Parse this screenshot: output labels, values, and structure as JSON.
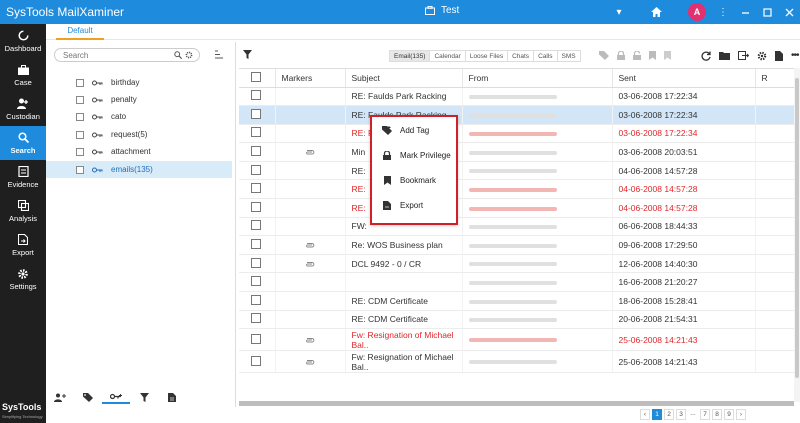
{
  "app": {
    "title": "SysTools MailXaminer",
    "case_name": "Test",
    "avatar_letter": "A"
  },
  "sidebar": {
    "items": [
      {
        "label": "Dashboard",
        "icon": "dashboard-icon"
      },
      {
        "label": "Case",
        "icon": "briefcase-icon"
      },
      {
        "label": "Custodian",
        "icon": "custodian-icon"
      },
      {
        "label": "Search",
        "icon": "search-icon",
        "active": true
      },
      {
        "label": "Evidence",
        "icon": "evidence-icon"
      },
      {
        "label": "Analysis",
        "icon": "analysis-icon"
      },
      {
        "label": "Export",
        "icon": "export-icon"
      },
      {
        "label": "Settings",
        "icon": "gear-icon"
      }
    ],
    "brand": "SysTools",
    "brand_tagline": "Simplifying Technology"
  },
  "tab": {
    "label": "Default"
  },
  "search": {
    "placeholder": "Search"
  },
  "tree": {
    "items": [
      {
        "label": "birthday"
      },
      {
        "label": "penalty"
      },
      {
        "label": "cato"
      },
      {
        "label": "request(5)"
      },
      {
        "label": "attachment"
      },
      {
        "label": "emails(135)",
        "selected": true
      }
    ]
  },
  "filter_tabs": [
    "Email(135)",
    "Calendar",
    "Loose Files",
    "Chats",
    "Calls",
    "SMS"
  ],
  "grid": {
    "headers": {
      "markers": "Markers",
      "subject": "Subject",
      "from": "From",
      "sent": "Sent",
      "r": "R"
    },
    "rows": [
      {
        "subject": "RE: Faulds Park Racking",
        "sent": "03-06-2008 17:22:34",
        "red": false,
        "attach": false
      },
      {
        "subject": "RE: Faulds Park Racking",
        "sent": "03-06-2008 17:22:34",
        "red": false,
        "attach": false,
        "selected": true
      },
      {
        "subject": "RE: Faulds",
        "sent": "03-06-2008 17:22:34",
        "red": true,
        "attach": false
      },
      {
        "subject": "Min",
        "sent": "03-06-2008 20:03:51",
        "red": false,
        "attach": true
      },
      {
        "subject": "RE:",
        "sent": "04-06-2008 14:57:28",
        "red": false,
        "attach": false
      },
      {
        "subject": "RE:",
        "sent": "04-06-2008 14:57:28",
        "red": true,
        "attach": false
      },
      {
        "subject": "RE:",
        "sent": "04-06-2008 14:57:28",
        "red": true,
        "attach": false
      },
      {
        "subject": "FW:",
        "sent": "06-06-2008 18:44:33",
        "red": false,
        "attach": false
      },
      {
        "subject": "Re: WOS Business plan",
        "sent": "09-06-2008 17:29:50",
        "red": false,
        "attach": true
      },
      {
        "subject": "DCL 9492 - 0 / CR",
        "sent": "12-06-2008 14:40:30",
        "red": false,
        "attach": true
      },
      {
        "subject": "",
        "sent": "16-06-2008 21:20:27",
        "red": false,
        "attach": false
      },
      {
        "subject": "RE: CDM Certificate",
        "sent": "18-06-2008 15:28:41",
        "red": false,
        "attach": false
      },
      {
        "subject": "RE: CDM Certificate",
        "sent": "20-06-2008 21:54:31",
        "red": false,
        "attach": false
      },
      {
        "subject": "Fw: Resignation of Michael Bal..",
        "sent": "25-06-2008 14:21:43",
        "red": true,
        "attach": true
      },
      {
        "subject": "Fw: Resignation of Michael Bal..",
        "sent": "25-06-2008 14:21:43",
        "red": false,
        "attach": true
      }
    ]
  },
  "context_menu": {
    "items": [
      {
        "label": "Add Tag",
        "icon": "tag-icon"
      },
      {
        "label": "Mark Privilege",
        "icon": "lock-icon"
      },
      {
        "label": "Bookmark",
        "icon": "bookmark-icon"
      },
      {
        "label": "Export",
        "icon": "export-file-icon"
      }
    ]
  },
  "pager": {
    "pages": [
      "‹",
      "1",
      "2",
      "3",
      "...",
      "7",
      "8",
      "9",
      "›"
    ],
    "active": "1"
  }
}
